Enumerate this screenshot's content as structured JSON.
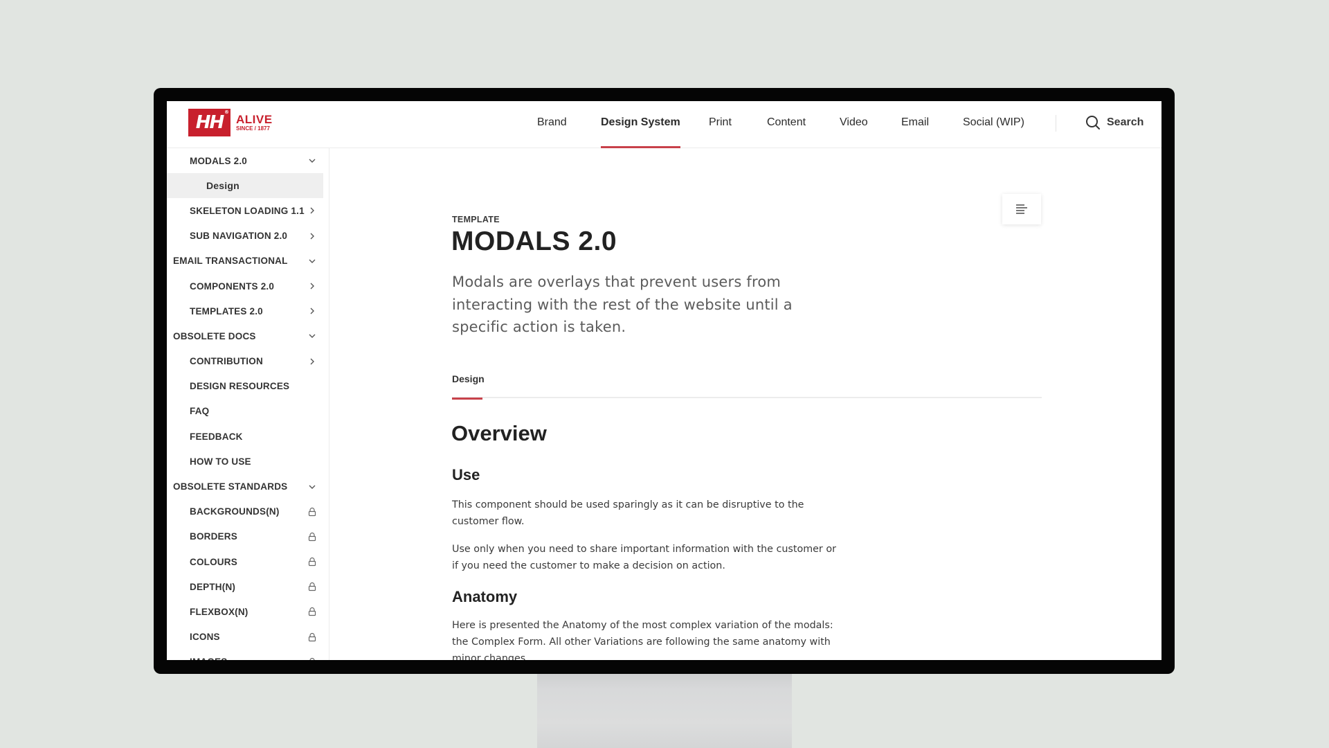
{
  "brand": {
    "logo_mark": "HH",
    "logo_registered": "®",
    "logo_title": "ALIVE",
    "logo_subtitle": "SINCE / 1877",
    "accent_color": "#c8202d"
  },
  "header": {
    "nav": [
      {
        "label": "Brand",
        "active": false
      },
      {
        "label": "Design System",
        "active": true
      },
      {
        "label": "Print",
        "active": false
      },
      {
        "label": "Content",
        "active": false
      },
      {
        "label": "Video",
        "active": false
      },
      {
        "label": "Email",
        "active": false
      },
      {
        "label": "Social (WIP)",
        "active": false
      }
    ],
    "search_label": "Search",
    "search_icon": "search-icon"
  },
  "sidebar": {
    "items": [
      {
        "label": "MODALS 2.0",
        "level": 1,
        "icon": "chevron-down-icon"
      },
      {
        "label": "Design",
        "level": 2,
        "icon": "",
        "selected": true
      },
      {
        "label": "SKELETON LOADING 1.1",
        "level": 1,
        "icon": "chevron-right-icon"
      },
      {
        "label": "SUB NAVIGATION 2.0",
        "level": 1,
        "icon": "chevron-right-icon"
      },
      {
        "label": "EMAIL TRANSACTIONAL",
        "level": 0,
        "icon": "chevron-down-icon"
      },
      {
        "label": "COMPONENTS 2.0",
        "level": 1,
        "icon": "chevron-right-icon"
      },
      {
        "label": "TEMPLATES 2.0",
        "level": 1,
        "icon": "chevron-right-icon"
      },
      {
        "label": "OBSOLETE DOCS",
        "level": 0,
        "icon": "chevron-down-icon"
      },
      {
        "label": "CONTRIBUTION",
        "level": 1,
        "icon": "chevron-right-icon"
      },
      {
        "label": "DESIGN RESOURCES",
        "level": 1,
        "icon": ""
      },
      {
        "label": "FAQ",
        "level": 1,
        "icon": ""
      },
      {
        "label": "FEEDBACK",
        "level": 1,
        "icon": ""
      },
      {
        "label": "HOW TO USE",
        "level": 1,
        "icon": ""
      },
      {
        "label": "OBSOLETE STANDARDS",
        "level": 0,
        "icon": "chevron-down-icon"
      },
      {
        "label": "BACKGROUNDS(N)",
        "level": 1,
        "icon": "lock-icon"
      },
      {
        "label": "BORDERS",
        "level": 1,
        "icon": "lock-icon"
      },
      {
        "label": "COLOURS",
        "level": 1,
        "icon": "lock-icon"
      },
      {
        "label": "DEPTH(N)",
        "level": 1,
        "icon": "lock-icon"
      },
      {
        "label": "FLEXBOX(N)",
        "level": 1,
        "icon": "lock-icon"
      },
      {
        "label": "ICONS",
        "level": 1,
        "icon": "lock-icon"
      },
      {
        "label": "IMAGES",
        "level": 1,
        "icon": "lock-icon"
      }
    ]
  },
  "main": {
    "eyebrow": "TEMPLATE",
    "title": "MODALS 2.0",
    "lead": "Modals are overlays that prevent users from interacting with the rest of the website until a specific action is taken.",
    "toc_icon": "table-of-contents-icon",
    "tabs": [
      {
        "label": "Design",
        "active": true
      }
    ],
    "overview_heading": "Overview",
    "use_heading": "Use",
    "use_paragraphs": [
      "This component should be used sparingly as it can be disruptive to the customer flow.",
      "Use only when you need to share important information with the customer or if you need the customer to make a decision on action."
    ],
    "anatomy_heading": "Anatomy",
    "anatomy_paragraph": "Here is presented the Anatomy of the most complex variation of the modals: the Complex Form. All other Variations are following the same anatomy with minor changes."
  }
}
